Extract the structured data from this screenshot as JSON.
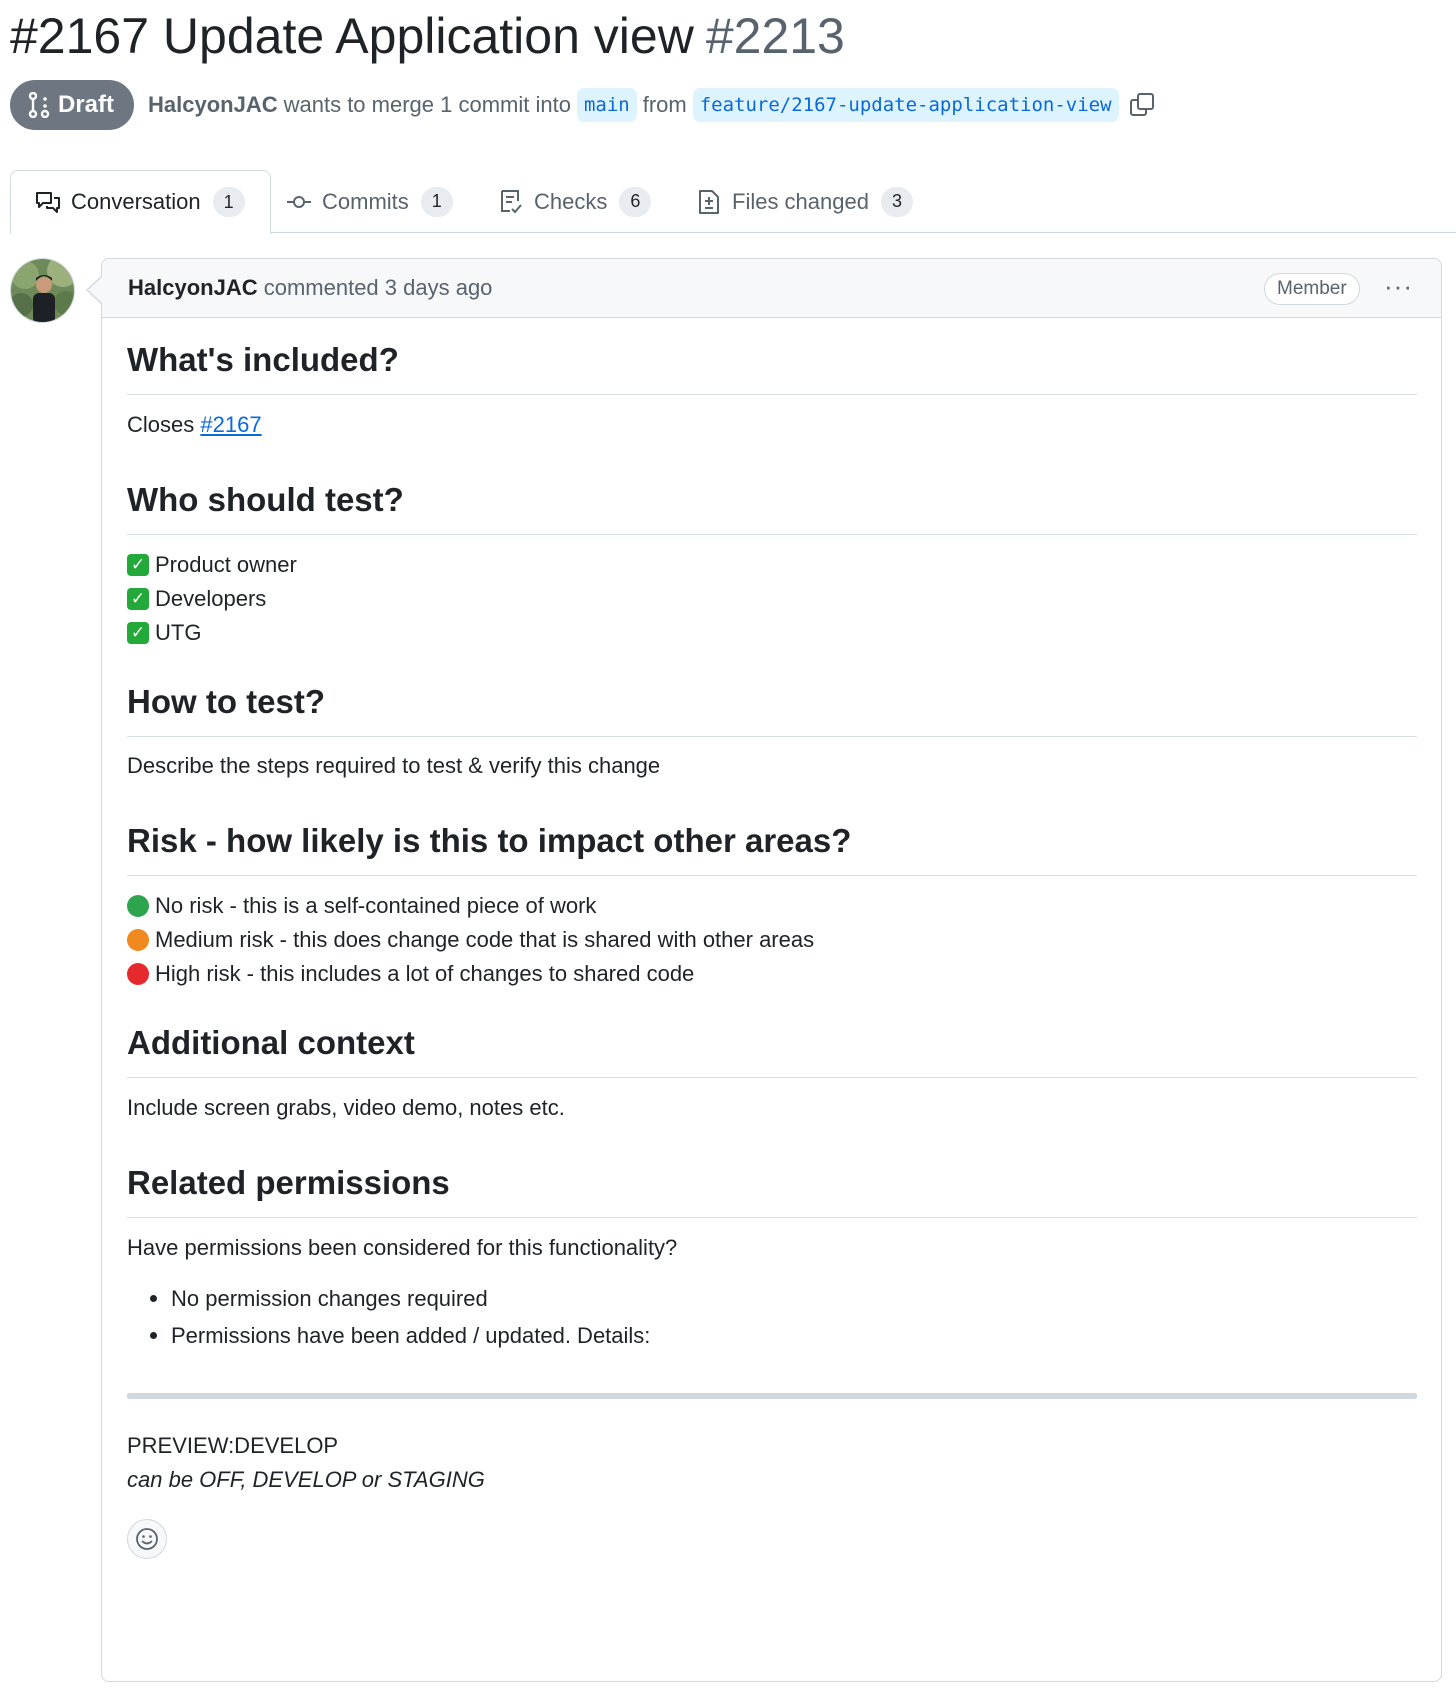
{
  "pr": {
    "title": "#2167 Update Application view",
    "number": "#2213",
    "state_label": "Draft",
    "author": "HalcyonJAC",
    "merge_text": "wants to merge 1 commit into",
    "base_branch": "main",
    "from_text": "from",
    "head_branch": "feature/2167-update-application-view"
  },
  "tabs": [
    {
      "label": "Conversation",
      "count": "1",
      "icon": "comment-discussion-icon"
    },
    {
      "label": "Commits",
      "count": "1",
      "icon": "git-commit-icon"
    },
    {
      "label": "Checks",
      "count": "6",
      "icon": "checklist-icon"
    },
    {
      "label": "Files changed",
      "count": "3",
      "icon": "file-diff-icon"
    }
  ],
  "comment": {
    "author": "HalcyonJAC",
    "action": "commented 3 days ago",
    "badge": "Member",
    "menu": "···",
    "sections": {
      "included_heading": "What's included?",
      "closes_text": "Closes",
      "closes_link": "#2167",
      "who_heading": "Who should test?",
      "who_items": [
        "Product owner",
        "Developers",
        "UTG"
      ],
      "how_heading": "How to test?",
      "how_text": "Describe the steps required to test & verify this change",
      "risk_heading": "Risk - how likely is this to impact other areas?",
      "risk_items": [
        {
          "label": "No risk - this is a self-contained piece of work",
          "color": "#2ea44f"
        },
        {
          "label": "Medium risk - this does change code that is shared with other areas",
          "color": "#f08a1e"
        },
        {
          "label": "High risk - this includes a lot of changes to shared code",
          "color": "#e5292d"
        }
      ],
      "context_heading": "Additional context",
      "context_text": "Include screen grabs, video demo, notes etc.",
      "perm_heading": "Related permissions",
      "perm_text": "Have permissions been considered for this functionality?",
      "perm_items": [
        "No permission changes required",
        "Permissions have been added / updated. Details:"
      ],
      "preview_text": "PREVIEW:DEVELOP",
      "preview_note": "can be OFF, DEVELOP or STAGING"
    }
  },
  "colors": {
    "link": "#0969da",
    "draft_badge": "#6e7781",
    "border": "#d1d9e0"
  }
}
